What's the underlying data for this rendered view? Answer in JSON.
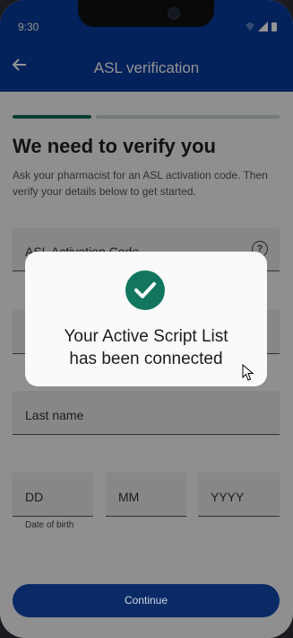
{
  "status_bar": {
    "time": "9:30"
  },
  "header": {
    "title": "ASL verification"
  },
  "intro": {
    "heading": "We need to verify you",
    "subtext": "Ask your pharmacist for an ASL activation code. Then verify your details below to get started."
  },
  "form": {
    "activation_code_label": "ASL Activation Code",
    "help_glyph": "?",
    "last_name_label": "Last name",
    "dob": {
      "day": "DD",
      "month": "MM",
      "year": "YYYY",
      "caption": "Date of birth"
    }
  },
  "actions": {
    "continue_label": "Continue"
  },
  "modal": {
    "message_line1": "Your Active Script List",
    "message_line2": "has been connected"
  },
  "colors": {
    "app_bar": "#063a9b",
    "progress_active": "#0d6e59",
    "success": "#11765d",
    "continue_button": "#0a2a66"
  },
  "icons": {
    "back": "arrow-left-icon",
    "help": "question-circle-icon",
    "success": "check-circle-icon"
  }
}
